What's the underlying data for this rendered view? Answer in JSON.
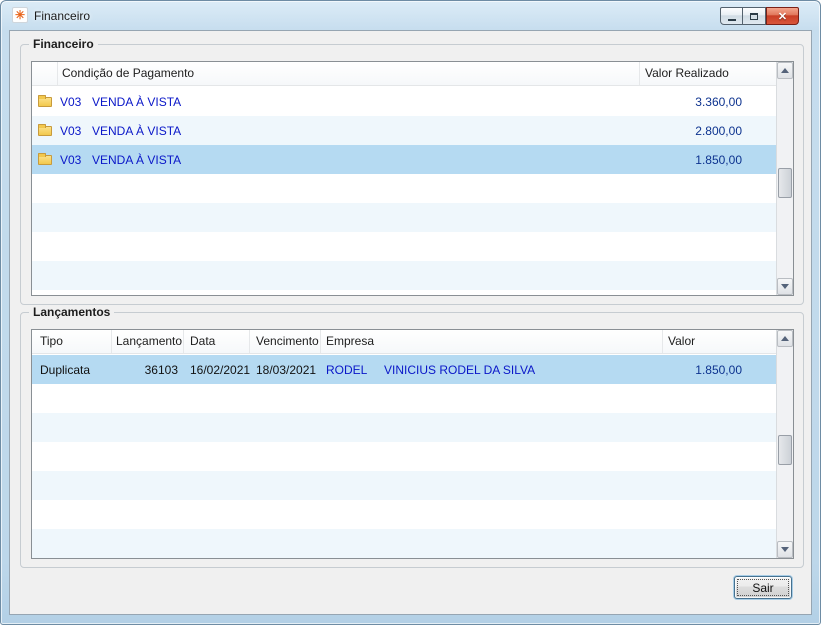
{
  "window": {
    "title": "Financeiro",
    "controls": {
      "minimize_icon": "minimize",
      "maximize_icon": "maximize",
      "close_icon": "✕"
    }
  },
  "colors": {
    "selection_blue": "#b5daf2",
    "stripe_blue": "#eff7fc",
    "item_text_blue": "#0a17c8",
    "value_text_navy": "#0d338f",
    "frame_blue": "#c6ddee",
    "close_button_red": "#c93d24"
  },
  "financeiro_group": {
    "title": "Financeiro",
    "table": {
      "columns": {
        "condicao": "Condição de Pagamento",
        "valor": "Valor Realizado"
      },
      "rows": [
        {
          "codigo": "V03",
          "descricao": "VENDA À VISTA",
          "valor": "3.360,00",
          "selected": false
        },
        {
          "codigo": "V03",
          "descricao": "VENDA À VISTA",
          "valor": "2.800,00",
          "selected": false
        },
        {
          "codigo": "V03",
          "descricao": "VENDA À VISTA",
          "valor": "1.850,00",
          "selected": true
        }
      ]
    }
  },
  "lancamentos_group": {
    "title": "Lançamentos",
    "table": {
      "columns": {
        "tipo": "Tipo",
        "lancamento": "Lançamento",
        "data": "Data",
        "vencimento": "Vencimento",
        "empresa": "Empresa",
        "valor": "Valor"
      },
      "rows": [
        {
          "tipo": "Duplicata",
          "lancamento": "36103",
          "data": "16/02/2021",
          "vencimento": "18/03/2021",
          "empresa_codigo": "RODEL",
          "empresa_nome": "VINICIUS RODEL DA SILVA",
          "valor": "1.850,00",
          "selected": true
        }
      ]
    }
  },
  "footer": {
    "sair_label": "Sair"
  }
}
